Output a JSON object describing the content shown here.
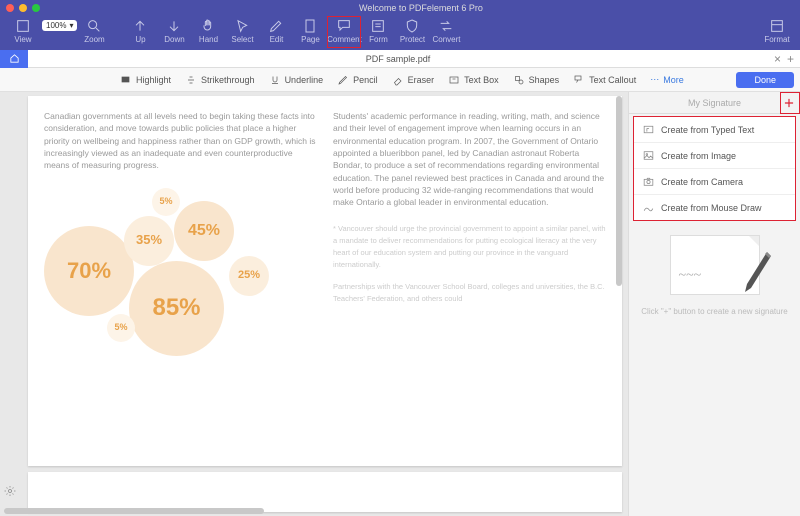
{
  "window": {
    "title": "Welcome to PDFelement 6 Pro"
  },
  "toolbar": {
    "view": "View",
    "zoom": "Zoom",
    "zoom_value": "100%",
    "up": "Up",
    "down": "Down",
    "hand": "Hand",
    "select": "Select",
    "edit": "Edit",
    "page": "Page",
    "comment": "Comment",
    "form": "Form",
    "protect": "Protect",
    "convert": "Convert",
    "format": "Format"
  },
  "tab": {
    "name": "PDF sample.pdf"
  },
  "subtoolbar": {
    "highlight": "Highlight",
    "strikethrough": "Strikethrough",
    "underline": "Underline",
    "pencil": "Pencil",
    "eraser": "Eraser",
    "textbox": "Text Box",
    "shapes": "Shapes",
    "textcallout": "Text Callout",
    "more": "More",
    "done": "Done"
  },
  "document": {
    "col1_p1": "Canadian governments at all levels need to begin taking these facts into consideration, and move towards public policies that place a higher priority on wellbeing and happiness rather than on GDP growth, which is increasingly viewed as an inadequate and even counterproductive means of measuring progress.",
    "col2_p1": "Students' academic performance in reading, writing, math, and science and their level of engagement improve when learning occurs in an environmental education program. In 2007, the Government of Ontario appointed a blueribbon panel, led by Canadian astronaut Roberta Bondar, to produce a set of recommendations regarding environmental education. The panel reviewed best practices in Canada and around the world before producing 32 wide-ranging recommendations that would make Ontario a global leader in environmental education.",
    "col2_p2": "* Vancouver should urge the provincial government to appoint a similar panel, with a mandate to deliver recommendations for putting ecological literacy at the very heart of our education system and putting our province in the vanguard internationally.",
    "col2_p3": "Partnerships with the Vancouver School Board, colleges and universities, the B.C. Teachers' Federation, and others could"
  },
  "chart_data": {
    "type": "bubble",
    "title": "",
    "series": [
      {
        "label": "70%",
        "value": 70,
        "size": 90,
        "x": 30,
        "y": 60
      },
      {
        "label": "35%",
        "value": 35,
        "size": 50,
        "x": 100,
        "y": 40
      },
      {
        "label": "45%",
        "value": 45,
        "size": 60,
        "x": 155,
        "y": 30
      },
      {
        "label": "85%",
        "value": 85,
        "size": 95,
        "x": 115,
        "y": 95
      },
      {
        "label": "25%",
        "value": 25,
        "size": 40,
        "x": 200,
        "y": 80
      },
      {
        "label": "5%",
        "value": 5,
        "size": 28,
        "x": 75,
        "y": 135
      },
      {
        "label": "5%",
        "value": 5,
        "size": 28,
        "x": 125,
        "y": 8
      }
    ]
  },
  "sidepanel": {
    "title": "My Signature",
    "menu": {
      "typed": "Create from Typed Text",
      "image": "Create from Image",
      "camera": "Create from Camera",
      "draw": "Create from Mouse Draw"
    },
    "hint": "Click \"+\" button to create a new signature"
  }
}
